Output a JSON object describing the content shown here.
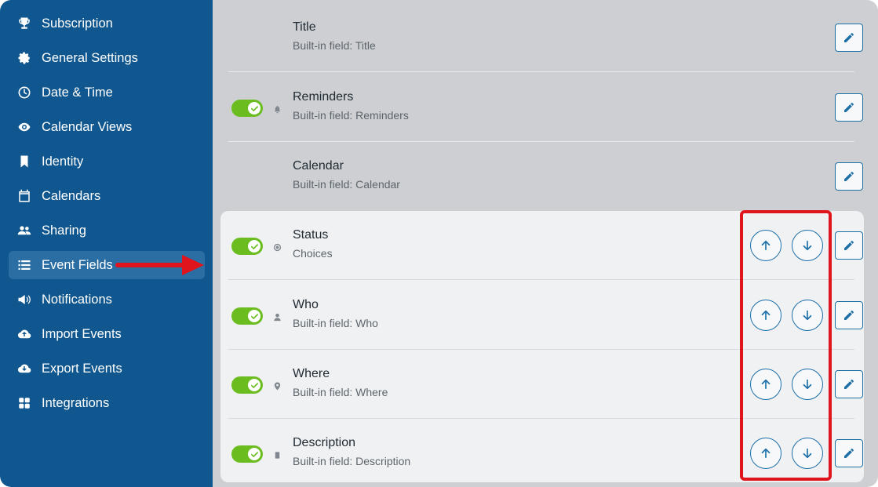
{
  "sidebar": {
    "items": [
      {
        "label": "Subscription",
        "icon": "trophy-icon"
      },
      {
        "label": "General Settings",
        "icon": "gear-icon"
      },
      {
        "label": "Date & Time",
        "icon": "clock-icon"
      },
      {
        "label": "Calendar Views",
        "icon": "eye-icon"
      },
      {
        "label": "Identity",
        "icon": "bookmark-icon"
      },
      {
        "label": "Calendars",
        "icon": "calendar-icon"
      },
      {
        "label": "Sharing",
        "icon": "users-icon"
      },
      {
        "label": "Event Fields",
        "icon": "list-icon",
        "active": true
      },
      {
        "label": "Notifications",
        "icon": "megaphone-icon"
      },
      {
        "label": "Import Events",
        "icon": "cloud-upload-icon"
      },
      {
        "label": "Export Events",
        "icon": "cloud-download-icon"
      },
      {
        "label": "Integrations",
        "icon": "grid-icon"
      }
    ]
  },
  "fields": [
    {
      "name": "Title",
      "subtitle": "Built-in field: Title",
      "toggle": false,
      "icon": null
    },
    {
      "name": "Reminders",
      "subtitle": "Built-in field: Reminders",
      "toggle": true,
      "icon": "bell-icon"
    },
    {
      "name": "Calendar",
      "subtitle": "Built-in field: Calendar",
      "toggle": false,
      "icon": null
    },
    {
      "name": "Status",
      "subtitle": "Choices",
      "toggle": true,
      "icon": "radio-icon",
      "reorderable": true
    },
    {
      "name": "Who",
      "subtitle": "Built-in field: Who",
      "toggle": true,
      "icon": "person-icon",
      "reorderable": true
    },
    {
      "name": "Where",
      "subtitle": "Built-in field: Where",
      "toggle": true,
      "icon": "map-pin-icon",
      "reorderable": true
    },
    {
      "name": "Description",
      "subtitle": "Built-in field: Description",
      "toggle": true,
      "icon": "document-icon",
      "reorderable": true
    }
  ],
  "colors": {
    "sidebar": "#10578f",
    "accent": "#1d6fa8",
    "toggle_on": "#6bbd1f",
    "annotation": "#e0141c"
  }
}
